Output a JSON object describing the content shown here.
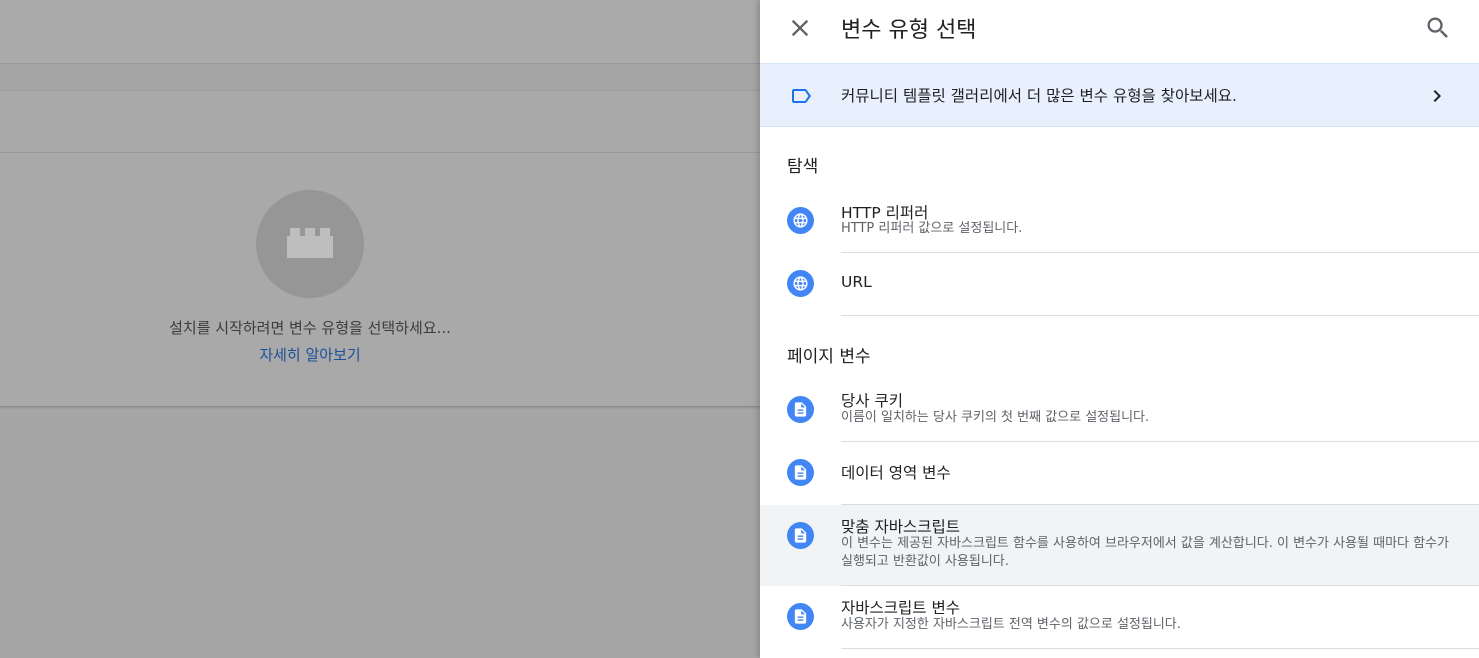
{
  "background": {
    "setup_prompt": "설치를 시작하려면 변수 유형을 선택하세요...",
    "learn_more": "자세히 알아보기"
  },
  "panel": {
    "title": "변수 유형 선택",
    "close_icon": "close-icon",
    "search_icon": "search-icon",
    "gallery_link": "커뮤니티 템플릿 갤러리에서 더 많은 변수 유형을 찾아보세요.",
    "sections": [
      {
        "title": "탐색",
        "items": [
          {
            "name": "HTTP 리퍼러",
            "desc": "HTTP 리퍼러 값으로 설정됩니다.",
            "icon": "globe-icon"
          },
          {
            "name": "URL",
            "desc": "",
            "icon": "globe-icon"
          }
        ]
      },
      {
        "title": "페이지 변수",
        "items": [
          {
            "name": "당사 쿠키",
            "desc": "이름이 일치하는 당사 쿠키의 첫 번째 값으로 설정됩니다.",
            "icon": "document-icon"
          },
          {
            "name": "데이터 영역 변수",
            "desc": "",
            "icon": "document-icon"
          },
          {
            "name": "맞춤 자바스크립트",
            "desc": "이 변수는 제공된 자바스크립트 함수를 사용하여 브라우저에서 값을 계산합니다. 이 변수가 사용될 때마다 함수가 실행되고 반환값이 사용됩니다.",
            "icon": "document-icon"
          },
          {
            "name": "자바스크립트 변수",
            "desc": "사용자가 지정한 자바스크립트 전역 변수의 값으로 설정됩니다.",
            "icon": "document-icon"
          }
        ]
      }
    ]
  },
  "colors": {
    "accent": "#4285f4",
    "gallery_bg": "#e8f0fe",
    "link": "#1c4f9a"
  }
}
